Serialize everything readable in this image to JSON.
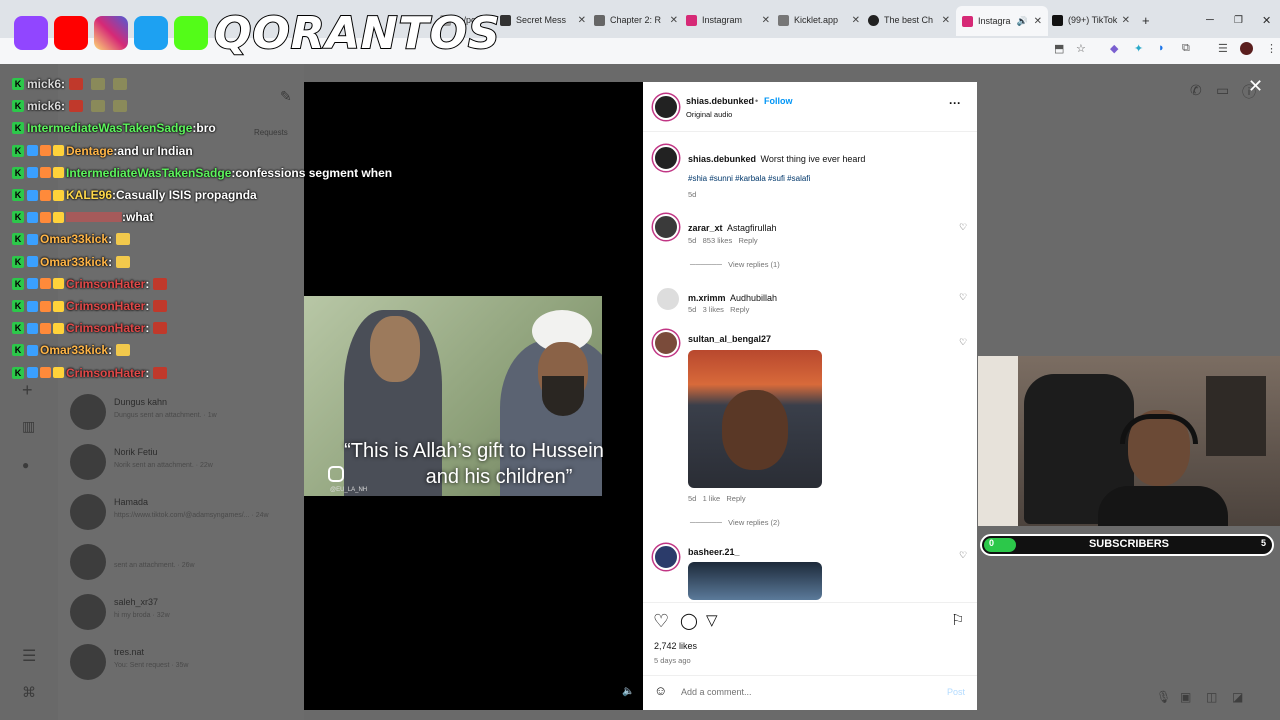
{
  "browser": {
    "tabs": [
      {
        "label": "m/po",
        "close": "✕",
        "color": "#888"
      },
      {
        "label": "Secret Mess",
        "close": "✕",
        "color": "#333"
      },
      {
        "label": "Chapter 2: R",
        "close": "✕",
        "color": "#555"
      },
      {
        "label": "Instagram",
        "close": "✕",
        "color": "#d62976"
      },
      {
        "label": "Kicklet.app",
        "close": "✕",
        "color": "#777"
      },
      {
        "label": "The best Ch",
        "close": "✕",
        "color": "#222"
      },
      {
        "label": "Instagra",
        "close": "✕",
        "color": "#d62976"
      },
      {
        "label": "(99+) TikTok",
        "close": "✕",
        "color": "#111"
      }
    ],
    "new_tab": "+"
  },
  "overlay": {
    "brand_name": "QORANTOS",
    "chat": [
      {
        "user": "mick6",
        "sep": " : ",
        "msg": "",
        "color": "#d9d9d9"
      },
      {
        "user": "mick6",
        "sep": " : ",
        "msg": "",
        "color": "#d9d9d9"
      },
      {
        "user": "IntermediateWasTakenSadge",
        "sep": " : ",
        "msg": "bro",
        "color": "#5cf55c"
      },
      {
        "user": "Dentage",
        "sep": " : ",
        "msg": "and ur Indian",
        "color": "#ffb547"
      },
      {
        "user": "IntermediateWasTakenSadge",
        "sep": " : ",
        "msg": "confessions segment when",
        "color": "#5cf55c"
      },
      {
        "user": "KALE96",
        "sep": " : ",
        "msg": "Casually      ISIS propagnda",
        "color": "#ffd84a"
      },
      {
        "user": "",
        "sep": " : ",
        "msg": "what",
        "color": "#e04848"
      },
      {
        "user": "Omar33kick",
        "sep": " : ",
        "msg": "",
        "color": "#ffb547"
      },
      {
        "user": "Omar33kick",
        "sep": " : ",
        "msg": "",
        "color": "#ffb547"
      },
      {
        "user": "CrimsonHater",
        "sep": " : ",
        "msg": "",
        "color": "#e04848"
      },
      {
        "user": "CrimsonHater",
        "sep": " : ",
        "msg": "",
        "color": "#e04848"
      },
      {
        "user": "CrimsonHater",
        "sep": " : ",
        "msg": "",
        "color": "#e04848"
      },
      {
        "user": "Omar33kick",
        "sep": " : ",
        "msg": "",
        "color": "#ffb547"
      },
      {
        "user": "CrimsonHater",
        "sep": " : ",
        "msg": "",
        "color": "#e04848"
      }
    ],
    "subscribers": {
      "label": "SUBSCRIBERS",
      "current": "0",
      "goal": "5"
    }
  },
  "dm_list": {
    "requests": "Requests",
    "conversations": [
      {
        "name": "Dungus kahn",
        "snippet": "Dungus sent an attachment. · 1w"
      },
      {
        "name": "Norik Fetiu",
        "snippet": "Norik sent an attachment. · 22w"
      },
      {
        "name": "Hamada",
        "snippet": "https://www.tiktok.com/@adamsyngames/... · 24w"
      },
      {
        "name": "",
        "snippet": "sent an attachment. · 26w"
      },
      {
        "name": "saleh_xr37",
        "snippet": "hi my broda · 32w"
      },
      {
        "name": "tres.nat",
        "snippet": "You: Sent request · 35w"
      }
    ]
  },
  "video": {
    "subtitle_line1": "“This is Allah’s gift to Hussein",
    "subtitle_line2": "and his children”",
    "watermark": "@EU_LA_NH"
  },
  "post": {
    "author": "shias.debunked",
    "dot": "•",
    "follow": "Follow",
    "audio": "Original audio",
    "more": "···",
    "caption": "Worst thing ive ever heard",
    "hashtags": "#shia #sunni #karbala #sufi #salafi",
    "caption_age": "5d",
    "comments": [
      {
        "user": "zarar_xt",
        "text": "Astagfirullah",
        "age": "5d",
        "likes": "853 likes",
        "reply": "Reply",
        "view_replies": "View replies (1)"
      },
      {
        "user": "m.xrimm",
        "text": "Audhubillah",
        "age": "5d",
        "likes": "3 likes",
        "reply": "Reply"
      },
      {
        "user": "sultan_al_bengal27",
        "text": "",
        "age": "5d",
        "likes": "1 like",
        "reply": "Reply",
        "view_replies": "View replies (2)"
      },
      {
        "user": "basheer.21_",
        "text": "",
        "age": "",
        "likes": "",
        "reply": ""
      }
    ],
    "likes_count": "2,742 likes",
    "posted_ago": "5 days ago",
    "comment_placeholder": "Add a comment...",
    "post_button": "Post"
  }
}
